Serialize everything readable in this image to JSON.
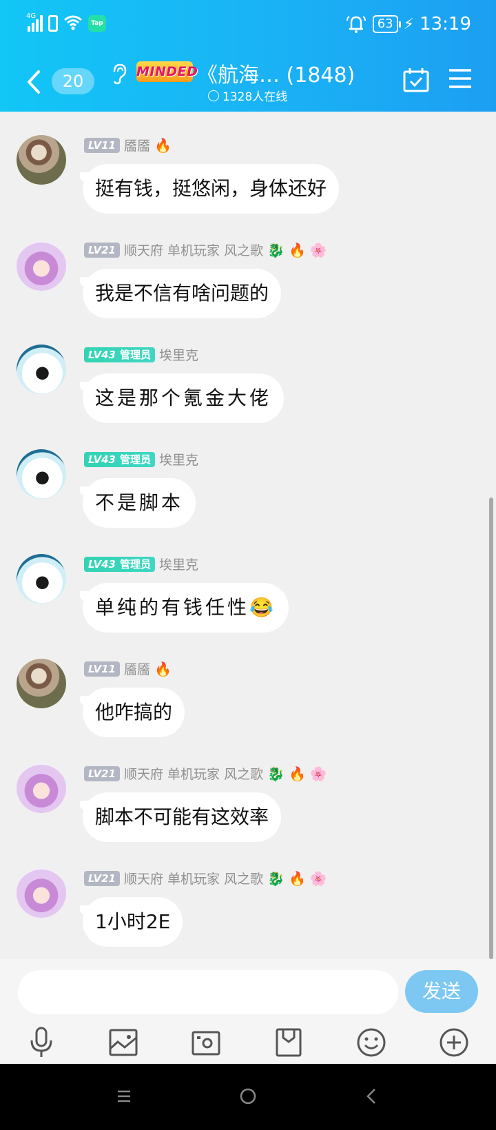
{
  "status_bar": {
    "network": "4G",
    "tap_badge": "Tap",
    "battery": "63",
    "time": "13:19"
  },
  "header": {
    "unread_count": "20",
    "tag": "MINDED",
    "title": "《航海…  (1848)",
    "online": "1328人在线"
  },
  "messages": [
    {
      "level": "LV11",
      "admin": "",
      "name": "靥靥",
      "badges": [
        "🔥"
      ],
      "text": "挺有钱，挺悠闲，身体还好",
      "avatar": "girl"
    },
    {
      "level": "LV21",
      "admin": "",
      "name": "顺天府 单机玩家 风之歌",
      "badges": [
        "🐉",
        "🔥",
        "🌸"
      ],
      "text": "我是不信有啥问题的",
      "avatar": "anime"
    },
    {
      "level": "LV43",
      "admin": "管理员",
      "name": "埃里克",
      "badges": [],
      "text": "这是那个氪金大佬",
      "avatar": "dog"
    },
    {
      "level": "LV43",
      "admin": "管理员",
      "name": "埃里克",
      "badges": [],
      "text": "不是脚本",
      "avatar": "dog"
    },
    {
      "level": "LV43",
      "admin": "管理员",
      "name": "埃里克",
      "badges": [],
      "text": "单纯的有钱任性😂",
      "avatar": "dog"
    },
    {
      "level": "LV11",
      "admin": "",
      "name": "靥靥",
      "badges": [
        "🔥"
      ],
      "text": "他咋搞的",
      "avatar": "girl"
    },
    {
      "level": "LV21",
      "admin": "",
      "name": "顺天府 单机玩家 风之歌",
      "badges": [
        "🐉",
        "🔥",
        "🌸"
      ],
      "text": "脚本不可能有这效率",
      "avatar": "anime"
    },
    {
      "level": "LV21",
      "admin": "",
      "name": "顺天府 单机玩家 风之歌",
      "badges": [
        "🐉",
        "🔥",
        "🌸"
      ],
      "text": "1小时2E",
      "avatar": "anime"
    }
  ],
  "composer": {
    "input_value": "",
    "send_label": "发送"
  },
  "toolbar": [
    "mic-icon",
    "image-icon",
    "camera-icon",
    "bag-icon",
    "emoji-icon",
    "plus-icon"
  ],
  "colors": {
    "header_start": "#12c6f6",
    "header_end": "#1c9ff2",
    "admin_badge": "#33d4b2",
    "send_button": "#7cc8f2",
    "background": "#f0f0f0"
  }
}
